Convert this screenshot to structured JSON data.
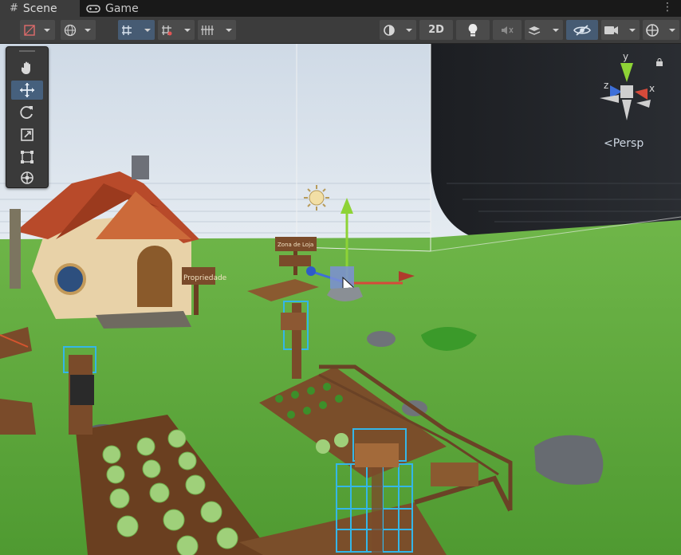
{
  "tabs": [
    {
      "label": "Scene",
      "icon": "hash-icon",
      "active": true
    },
    {
      "label": "Game",
      "icon": "gamepad-icon",
      "active": false
    }
  ],
  "toolbar": {
    "label_2d": "2D",
    "accent": "#465b73"
  },
  "tools": [
    "hand-tool",
    "move-tool",
    "rotate-tool",
    "scale-tool",
    "rect-tool",
    "transform-tool"
  ],
  "gizmo": {
    "persp_label": "Persp",
    "axes": {
      "x": "x",
      "y": "y",
      "z": "z"
    },
    "colors": {
      "x": "#d64a3a",
      "y": "#8ed336",
      "z": "#3d6fd9"
    }
  },
  "signs": {
    "house_sign": "Propriedade",
    "field_sign": "Zona de Loja"
  }
}
